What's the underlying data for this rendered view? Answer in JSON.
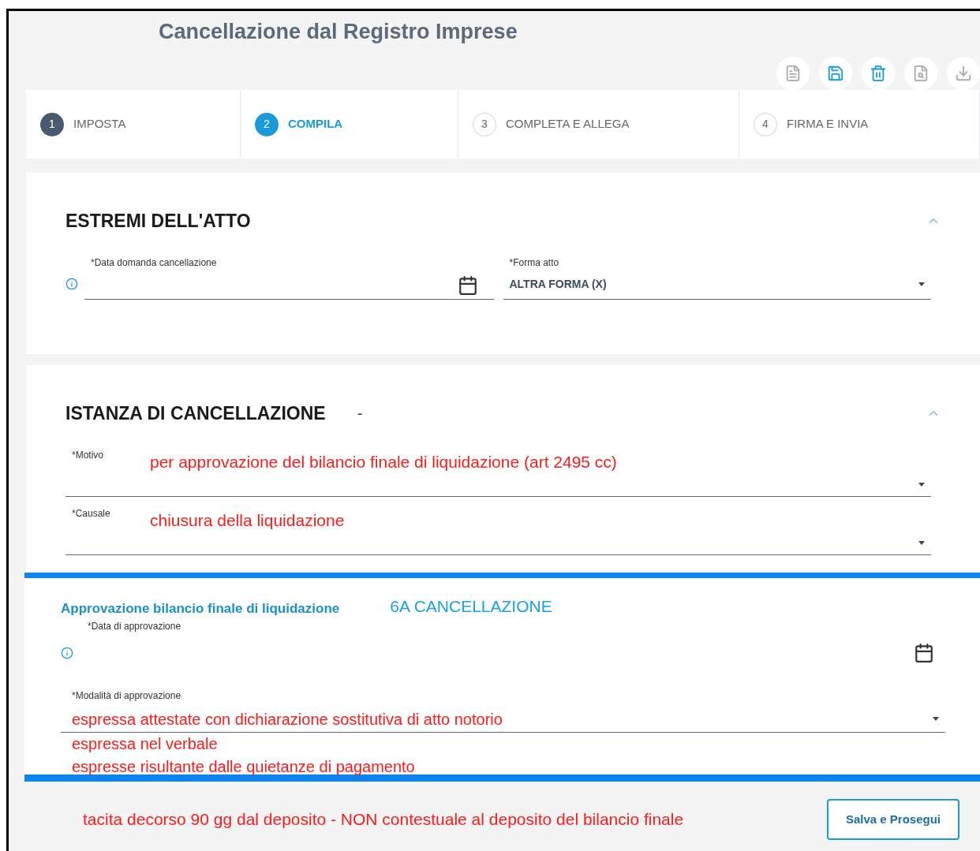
{
  "title": "Cancellazione dal Registro Imprese",
  "toolbar": [
    {
      "kind": "document",
      "disabled": true
    },
    {
      "kind": "save",
      "disabled": false
    },
    {
      "kind": "delete",
      "disabled": false
    },
    {
      "kind": "preview",
      "disabled": true
    },
    {
      "kind": "download",
      "disabled": true
    }
  ],
  "steps": [
    {
      "number": "1",
      "label": "IMPOSTA",
      "selected": false,
      "done": true
    },
    {
      "number": "2",
      "label": "COMPILA",
      "selected": true,
      "done": false
    },
    {
      "number": "3",
      "label": "COMPLETA E ALLEGA",
      "selected": false,
      "done": false
    },
    {
      "number": "4",
      "label": "FIRMA E INVIA",
      "selected": false,
      "done": false
    }
  ],
  "sections": [
    {
      "title": "ESTREMI DELL'ATTO",
      "expanded": true,
      "fields": [
        {
          "kind": "date",
          "label": "*Data domanda cancellazione"
        },
        {
          "kind": "select",
          "label": "*Forma atto",
          "value": "ALTRA FORMA (X)"
        }
      ]
    },
    {
      "title": "ISTANZA DI CANCELLAZIONE",
      "suffix": "-",
      "expanded": true,
      "fields": [
        {
          "kind": "note-select",
          "label": "*Motivo",
          "note": "per approvazione del bilancio finale di liquidazione (art 2495 cc)"
        },
        {
          "kind": "note-select",
          "label": "*Causale",
          "note": "chiusura della liquidazione"
        }
      ]
    }
  ],
  "subsection": {
    "title": "Approvazione bilancio finale di liquidazione",
    "note": "6A CANCELLAZIONE",
    "date_label": "*Data di approvazione",
    "select_label": "*Modalità di approvazione",
    "options": [
      "espressa attestate con dichiarazione sostitutiva di atto notorio",
      "espressa nel verbale",
      "espresse risultante dalle quietanze di pagamento"
    ]
  },
  "footer_note": "tacita decorso 90 gg dal deposito - NON contestuale al deposito del bilancio finale",
  "button": "Salva e Prosegui"
}
